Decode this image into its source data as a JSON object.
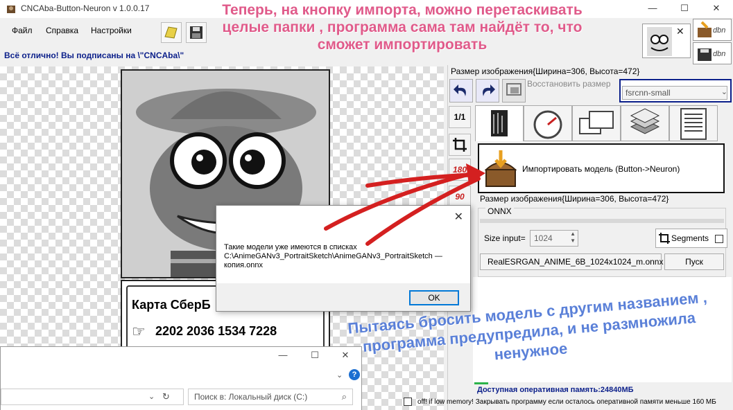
{
  "window": {
    "title": "CNCAba-Button-Neuron v 1.0.0.17",
    "minimize": "—",
    "maximize": "☐",
    "close": "✕"
  },
  "menu": {
    "file": "Файл",
    "help": "Справка",
    "settings": "Настройки"
  },
  "status_top": "Всё отлично! Вы подписаны на \\\"CNCAba\\\"",
  "card": {
    "title": "Карта СберБ",
    "number": "2202 2036 1534 7228"
  },
  "explorer": {
    "minimize": "—",
    "maximize": "☐",
    "close": "✕",
    "search_placeholder": "Поиск в: Локальный диск (C:)"
  },
  "right": {
    "size_label": "Размер изображения{Ширина=306, Высота=472}",
    "restore_label": "Восстановить размер",
    "model_value": "fsrcnn-small",
    "scale_label": "1/1",
    "rotate180_label": "180",
    "rotate90_label": "90",
    "import_label": "Импортировать модель  (Button->Neuron)",
    "size_label2": "Размер изображения{Ширина=306, Высота=472}",
    "onnx_title": "ONNX",
    "size_input_label": "Size input=",
    "size_input_value": "1024",
    "segments_label": "Segments",
    "onnx_model": "RealESRGAN_ANIME_6B_1024x1024_m.onnx",
    "start_label": "Пуск",
    "memory_label": "Доступная оперативная память:24840МБ",
    "bottom_label": "off!  if  low memory! Закрывать  программу если   осталось оперативной памяти   меньше 160 МБ"
  },
  "thumbs": {
    "label1": "dbn",
    "label2": "dbn",
    "close": "✕"
  },
  "dialog": {
    "close": "✕",
    "line1": "Такие модели уже имеются в списках",
    "line2": " C:\\AnimeGANv3_PortraitSketch\\AnimeGANv3_PortraitSketch —",
    "line3": "копия.onnx",
    "ok": "OK"
  },
  "annotations": {
    "top": "Теперь, на кнопку импорта, можно перетаскивать целые папки , программа сама там найдёт то, что сможет импортировать",
    "bottom": "Пытаясь бросить модель с другим названием , программа предупредила, и не размножила ненужное"
  },
  "colors": {
    "accent_blue": "#0b1f8a",
    "annotation_pink": "#e05a8a",
    "annotation_blue": "#5a80d8",
    "arrow_red": "#d42020",
    "ok_border": "#0078d7"
  }
}
